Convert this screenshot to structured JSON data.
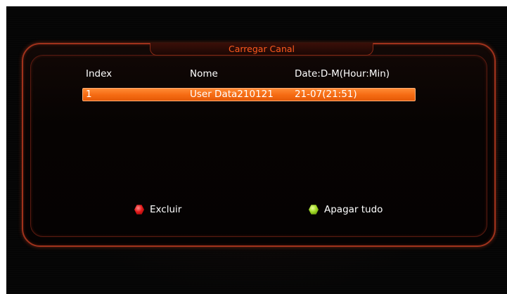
{
  "dialog": {
    "title": "Carregar Canal"
  },
  "table": {
    "columns": [
      "Index",
      "Nome",
      "Date:D-M(Hour:Min)"
    ],
    "rows": [
      {
        "index": "1",
        "name": "User Data210121",
        "date": "21-07(21:51)",
        "selected": true
      }
    ]
  },
  "legend": {
    "red": {
      "label": "Excluir",
      "color": "#e01818",
      "icon": "red-button-icon"
    },
    "green": {
      "label": "Apagar tudo",
      "color": "#9ed622",
      "icon": "green-button-icon"
    }
  },
  "colors": {
    "accent": "#f56a12",
    "title": "#ff5a1e",
    "border": "#a0321c"
  }
}
